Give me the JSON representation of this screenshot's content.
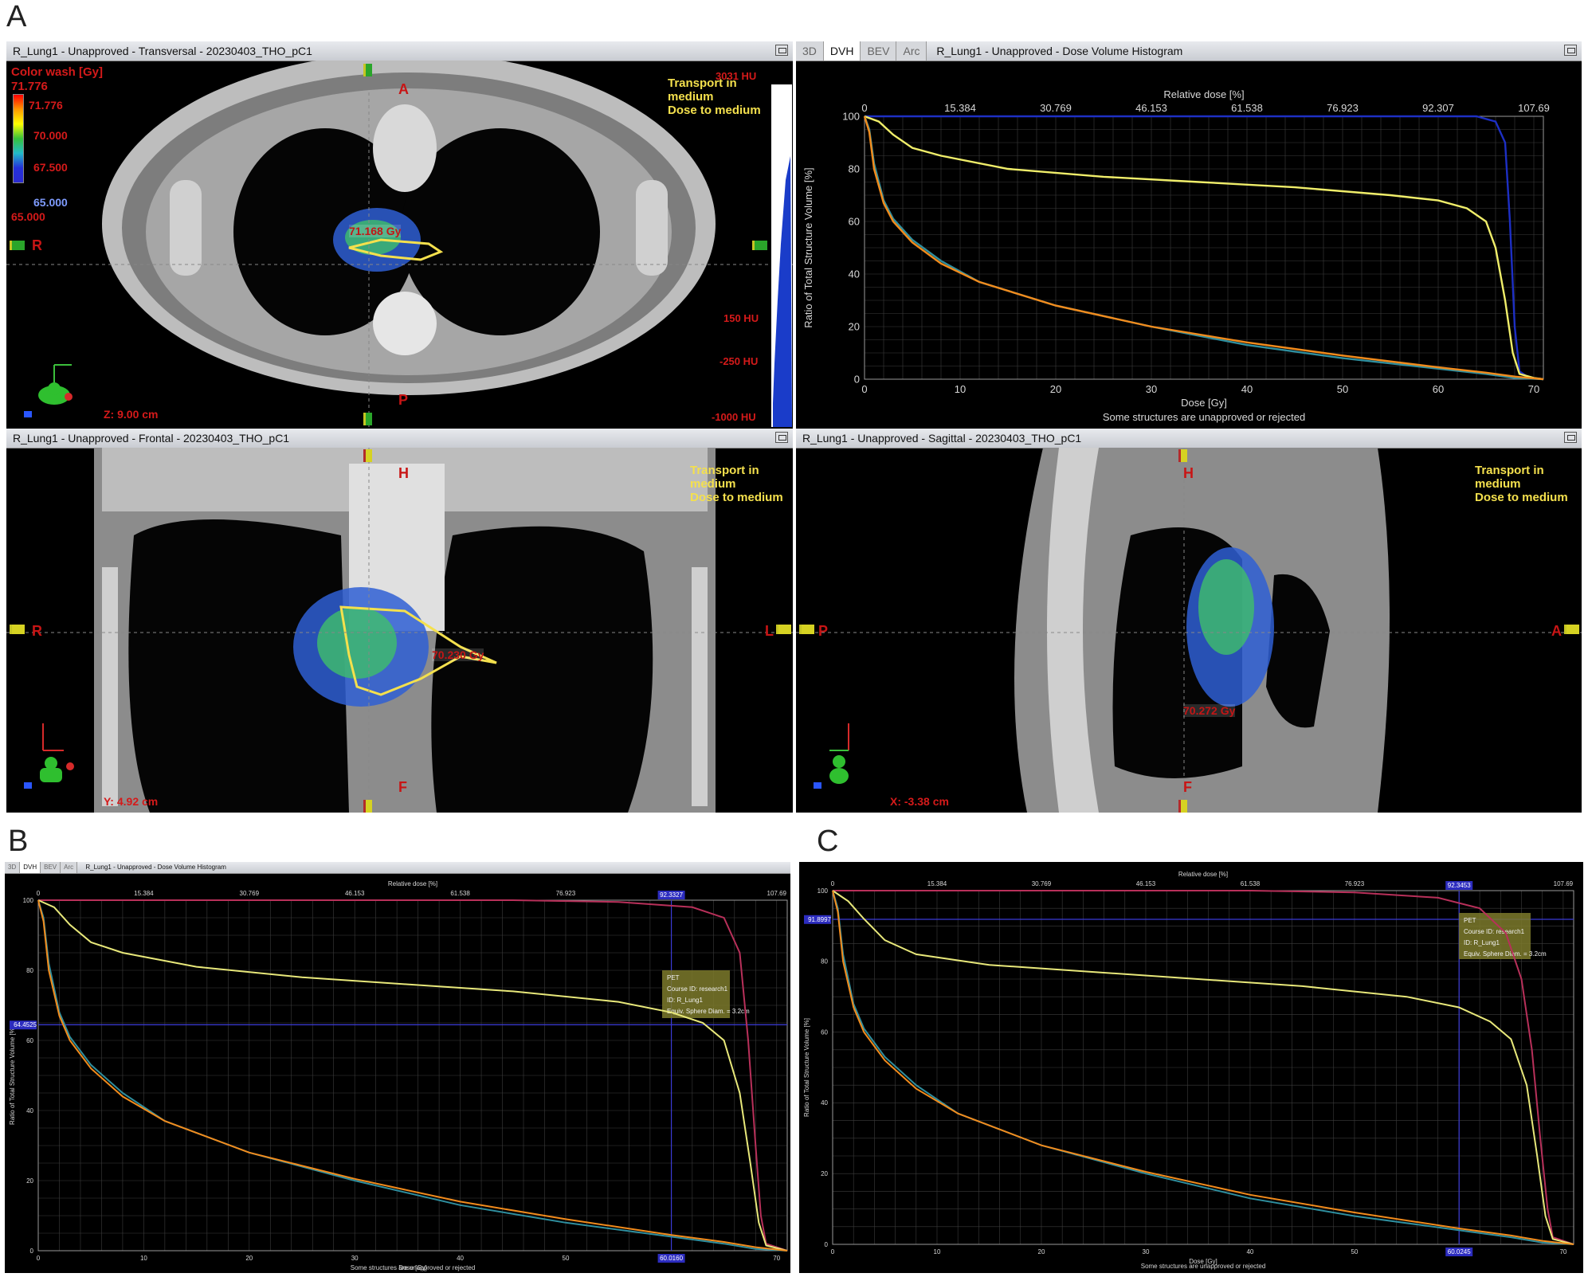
{
  "panel_letters": {
    "a": "A",
    "b": "B",
    "c": "C"
  },
  "transversal": {
    "title": "R_Lung1  -  Unapproved - Transversal - 20230403_THO_pC1",
    "color_wash_label": "Color wash [Gy]",
    "cw_max": "71.776",
    "cw_top": "71.776",
    "cw_70": "70.000",
    "cw_675": "67.500",
    "cw_65": "65.000",
    "cw_min": "65.000",
    "transport_line1": "Transport in",
    "transport_line2": "medium",
    "transport_line3": "Dose to medium",
    "hu_top": "3031 HU",
    "hu_150": "150 HU",
    "hu_m250": "-250 HU",
    "hu_m1000": "-1000 HU",
    "dose_label": "71.168 Gy",
    "z_coord": "Z: 9.00 cm",
    "orient_a": "A",
    "orient_p": "P",
    "orient_r": "R"
  },
  "dvh_main": {
    "tabs": [
      "3D",
      "DVH",
      "BEV",
      "Arc"
    ],
    "active_tab": "DVH",
    "title": "R_Lung1  -  Unapproved - Dose Volume Histogram",
    "top_axis_label": "Relative dose [%]",
    "top_ticks": [
      "0",
      "15.384",
      "30.769",
      "46.153",
      "61.538",
      "76.923",
      "92.307",
      "107.69"
    ],
    "ylabel": "Ratio of Total Structure Volume [%]",
    "xlabel": "Dose [Gy]",
    "footer": "Some structures are unapproved or rejected"
  },
  "frontal": {
    "title": "R_Lung1  -  Unapproved - Frontal - 20230403_THO_pC1",
    "transport_line1": "Transport in",
    "transport_line2": "medium",
    "transport_line3": "Dose to medium",
    "dose_label": "70.230 Gy",
    "y_coord": "Y: 4.92 cm",
    "orient_h": "H",
    "orient_f": "F",
    "orient_r": "R",
    "orient_l": "L"
  },
  "sagittal": {
    "title": "R_Lung1  -  Unapproved - Sagittal - 20230403_THO_pC1",
    "transport_line1": "Transport in",
    "transport_line2": "medium",
    "transport_line3": "Dose to medium",
    "dose_label": "70.272 Gy",
    "x_coord": "X: -3.38 cm",
    "orient_h": "H",
    "orient_f": "F",
    "orient_p": "P",
    "orient_a": "A"
  },
  "dvh_b": {
    "tabs": [
      "3D",
      "DVH",
      "BEV",
      "Arc"
    ],
    "title": "R_Lung1 - Unapproved - Dose Volume Histogram",
    "top_axis_label": "Relative dose [%]",
    "cursor_top": "92.3327",
    "cursor_left": "64.4525",
    "cursor_bottom": "60.0160",
    "tooltip": [
      "PET",
      "Course ID: research1",
      "ID: R_Lung1",
      "Equiv. Sphere Diam. = 3.2cm"
    ],
    "ylabel": "Ratio of Total Structure Volume [%]",
    "xlabel": "Dose [Gy]",
    "footer": "Some structures are unapproved or rejected"
  },
  "dvh_c": {
    "top_axis_label": "Relative dose [%]",
    "cursor_top": "92.3453",
    "cursor_left": "91.8997",
    "cursor_bottom": "60.0245",
    "tooltip": [
      "PET",
      "Course ID: research1",
      "ID: R_Lung1",
      "Equiv. Sphere Diam. = 3.2cm"
    ],
    "ylabel": "Ratio of Total Structure Volume [%]",
    "xlabel": "Dose [Gy]",
    "footer": "Some structures are unapproved or rejected"
  },
  "chart_data": [
    {
      "type": "line",
      "panel": "A",
      "title": "",
      "xlabel": "Dose [Gy]",
      "ylabel": "Ratio of Total Structure Volume [%]",
      "x_ticks": [
        0,
        10,
        20,
        30,
        40,
        50,
        60,
        70
      ],
      "y_ticks": [
        0,
        20,
        40,
        60,
        80,
        100
      ],
      "xlim": [
        0,
        71
      ],
      "ylim": [
        0,
        100
      ],
      "top_axis": {
        "label": "Relative dose [%]",
        "ticks": [
          "0",
          "15.384",
          "30.769",
          "46.153",
          "61.538",
          "76.923",
          "92.307",
          "107.69"
        ]
      },
      "grid": true,
      "series": [
        {
          "color": "#1d2fc4",
          "points": [
            [
              0,
              100
            ],
            [
              60,
              100
            ],
            [
              64,
              100
            ],
            [
              66,
              98
            ],
            [
              67,
              90
            ],
            [
              67.5,
              60
            ],
            [
              68,
              20
            ],
            [
              68.5,
              3
            ],
            [
              69.5,
              0.5
            ],
            [
              71,
              0
            ]
          ]
        },
        {
          "color": "#f0ee6a",
          "points": [
            [
              0,
              100
            ],
            [
              1.5,
              98
            ],
            [
              3,
              93
            ],
            [
              5,
              88
            ],
            [
              8,
              85
            ],
            [
              15,
              80
            ],
            [
              25,
              77
            ],
            [
              35,
              75
            ],
            [
              45,
              73
            ],
            [
              55,
              70
            ],
            [
              60,
              68
            ],
            [
              63,
              65
            ],
            [
              65,
              60
            ],
            [
              66,
              50
            ],
            [
              67,
              30
            ],
            [
              67.8,
              10
            ],
            [
              68.5,
              2
            ],
            [
              70,
              0.5
            ],
            [
              71,
              0
            ]
          ]
        },
        {
          "color": "#2f8f9f",
          "points": [
            [
              0,
              100
            ],
            [
              0.5,
              95
            ],
            [
              1,
              82
            ],
            [
              2,
              68
            ],
            [
              3,
              61
            ],
            [
              5,
              53
            ],
            [
              8,
              45
            ],
            [
              12,
              37
            ],
            [
              20,
              28
            ],
            [
              30,
              20
            ],
            [
              40,
              13
            ],
            [
              50,
              8
            ],
            [
              60,
              4
            ],
            [
              65,
              2
            ],
            [
              68,
              0.5
            ],
            [
              71,
              0
            ]
          ]
        },
        {
          "color": "#f28b1c",
          "points": [
            [
              0,
              100
            ],
            [
              0.5,
              94
            ],
            [
              1,
              80
            ],
            [
              2,
              67
            ],
            [
              3,
              60
            ],
            [
              5,
              52
            ],
            [
              8,
              44
            ],
            [
              12,
              37
            ],
            [
              20,
              28
            ],
            [
              30,
              20
            ],
            [
              40,
              14
            ],
            [
              50,
              9
            ],
            [
              60,
              4.5
            ],
            [
              65,
              2.5
            ],
            [
              68,
              1
            ],
            [
              71,
              0
            ]
          ]
        }
      ]
    },
    {
      "type": "line",
      "panel": "B",
      "xlabel": "Dose [Gy]",
      "ylabel": "Ratio of Total Structure Volume [%]",
      "x_ticks": [
        0,
        10,
        20,
        30,
        40,
        50,
        60,
        70
      ],
      "y_ticks": [
        0,
        20,
        40,
        60,
        80,
        100
      ],
      "xlim": [
        0,
        71
      ],
      "ylim": [
        0,
        100
      ],
      "top_axis": {
        "label": "Relative dose [%]",
        "ticks": [
          "0",
          "15.384",
          "30.769",
          "46.153",
          "61.538",
          "76.923",
          "92.307",
          "107.69"
        ]
      },
      "cursor": {
        "x": 60.016,
        "y": 64.4525
      },
      "grid": true,
      "series": [
        {
          "color": "#b8305a",
          "points": [
            [
              0,
              100
            ],
            [
              45,
              100
            ],
            [
              55,
              99.5
            ],
            [
              62,
              98
            ],
            [
              65,
              95
            ],
            [
              66.5,
              85
            ],
            [
              67.3,
              60
            ],
            [
              68,
              30
            ],
            [
              68.5,
              10
            ],
            [
              69,
              2
            ],
            [
              71,
              0
            ]
          ]
        },
        {
          "color": "#e8e87a",
          "points": [
            [
              0,
              100
            ],
            [
              1.5,
              98
            ],
            [
              3,
              93
            ],
            [
              5,
              88
            ],
            [
              8,
              85
            ],
            [
              15,
              81
            ],
            [
              25,
              78
            ],
            [
              35,
              76
            ],
            [
              45,
              74
            ],
            [
              55,
              71
            ],
            [
              60,
              68
            ],
            [
              63,
              65
            ],
            [
              65,
              60
            ],
            [
              66.5,
              45
            ],
            [
              67.5,
              25
            ],
            [
              68.3,
              8
            ],
            [
              69,
              1.5
            ],
            [
              71,
              0
            ]
          ]
        },
        {
          "color": "#2f8f9f",
          "points": [
            [
              0,
              100
            ],
            [
              0.5,
              95
            ],
            [
              1,
              82
            ],
            [
              2,
              68
            ],
            [
              3,
              61
            ],
            [
              5,
              53
            ],
            [
              8,
              45
            ],
            [
              12,
              37
            ],
            [
              20,
              28
            ],
            [
              30,
              20
            ],
            [
              40,
              13
            ],
            [
              50,
              8
            ],
            [
              60,
              4
            ],
            [
              65,
              2
            ],
            [
              68,
              0.5
            ],
            [
              71,
              0
            ]
          ]
        },
        {
          "color": "#f28b1c",
          "points": [
            [
              0,
              100
            ],
            [
              0.5,
              94
            ],
            [
              1,
              80
            ],
            [
              2,
              67
            ],
            [
              3,
              60
            ],
            [
              5,
              52
            ],
            [
              8,
              44
            ],
            [
              12,
              37
            ],
            [
              20,
              28
            ],
            [
              30,
              20.5
            ],
            [
              40,
              14
            ],
            [
              50,
              9
            ],
            [
              60,
              4.5
            ],
            [
              65,
              2.5
            ],
            [
              68,
              1
            ],
            [
              71,
              0
            ]
          ]
        }
      ]
    },
    {
      "type": "line",
      "panel": "C",
      "xlabel": "Dose [Gy]",
      "ylabel": "Ratio of Total Structure Volume [%]",
      "x_ticks": [
        0,
        10,
        20,
        30,
        40,
        50,
        60,
        70
      ],
      "y_ticks": [
        0,
        20,
        40,
        60,
        80,
        100
      ],
      "xlim": [
        0,
        71
      ],
      "ylim": [
        0,
        100
      ],
      "top_axis": {
        "label": "Relative dose [%]",
        "ticks": [
          "0",
          "15.384",
          "30.769",
          "46.153",
          "61.538",
          "76.923",
          "92.307",
          "107.69"
        ]
      },
      "cursor": {
        "x": 60.0245,
        "y": 91.8997
      },
      "grid": true,
      "series": [
        {
          "color": "#b8305a",
          "points": [
            [
              0,
              100
            ],
            [
              40,
              100
            ],
            [
              50,
              99.5
            ],
            [
              58,
              98
            ],
            [
              62,
              95
            ],
            [
              64.5,
              88
            ],
            [
              66,
              75
            ],
            [
              67,
              55
            ],
            [
              67.8,
              30
            ],
            [
              68.5,
              10
            ],
            [
              69,
              2
            ],
            [
              71,
              0
            ]
          ]
        },
        {
          "color": "#e8e87a",
          "points": [
            [
              0,
              100
            ],
            [
              1.5,
              97
            ],
            [
              3,
              92
            ],
            [
              5,
              86
            ],
            [
              8,
              82
            ],
            [
              15,
              79
            ],
            [
              25,
              77
            ],
            [
              35,
              75
            ],
            [
              45,
              73
            ],
            [
              55,
              70
            ],
            [
              60,
              67
            ],
            [
              63,
              63
            ],
            [
              65,
              58
            ],
            [
              66.5,
              45
            ],
            [
              67.5,
              25
            ],
            [
              68.3,
              8
            ],
            [
              69,
              1.5
            ],
            [
              71,
              0
            ]
          ]
        },
        {
          "color": "#2f8f9f",
          "points": [
            [
              0,
              100
            ],
            [
              0.5,
              95
            ],
            [
              1,
              82
            ],
            [
              2,
              68
            ],
            [
              3,
              61
            ],
            [
              5,
              53
            ],
            [
              8,
              45
            ],
            [
              12,
              37
            ],
            [
              20,
              28
            ],
            [
              30,
              20
            ],
            [
              40,
              13
            ],
            [
              50,
              8
            ],
            [
              60,
              4
            ],
            [
              65,
              2
            ],
            [
              68,
              0.5
            ],
            [
              71,
              0
            ]
          ]
        },
        {
          "color": "#f28b1c",
          "points": [
            [
              0,
              100
            ],
            [
              0.5,
              94
            ],
            [
              1,
              80
            ],
            [
              2,
              67
            ],
            [
              3,
              60
            ],
            [
              5,
              52
            ],
            [
              8,
              44
            ],
            [
              12,
              37
            ],
            [
              20,
              28
            ],
            [
              30,
              20.5
            ],
            [
              40,
              14
            ],
            [
              50,
              9
            ],
            [
              60,
              4.5
            ],
            [
              65,
              2.5
            ],
            [
              68,
              1
            ],
            [
              71,
              0
            ]
          ]
        }
      ]
    }
  ]
}
